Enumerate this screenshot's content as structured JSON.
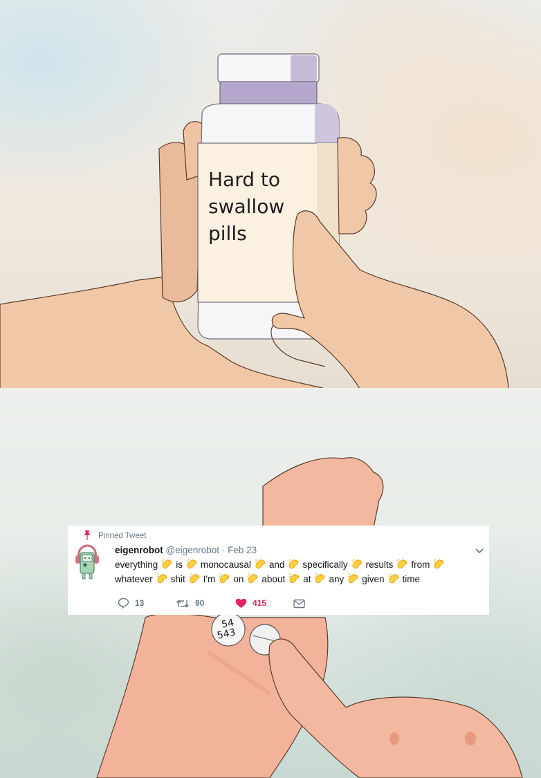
{
  "meme": {
    "label_lines": [
      "Hard to",
      "swallow",
      "pills"
    ],
    "pill_imprint": [
      "54",
      "543"
    ]
  },
  "tweet": {
    "pinned_label": "Pinned Tweet",
    "display_name": "eigenrobot",
    "handle": "@eigenrobot",
    "separator": "·",
    "date": "Feb 23",
    "line1": [
      "everything",
      "is",
      "monocausal",
      "and",
      "specifically",
      "results",
      "from"
    ],
    "line2": [
      "whatever",
      "shit",
      "I'm",
      "on",
      "about",
      "at",
      "any",
      "given",
      "time"
    ],
    "reply_count": "13",
    "retweet_count": "90",
    "like_count": "415",
    "icons": [
      "pin-icon",
      "avatar",
      "chevron-down-icon",
      "clap-emoji",
      "reply-icon",
      "retweet-icon",
      "heart-icon",
      "envelope-icon"
    ],
    "colors": {
      "like": "#e0245e",
      "muted": "#657786",
      "text": "#14171a",
      "pin": "#e0245e"
    }
  }
}
